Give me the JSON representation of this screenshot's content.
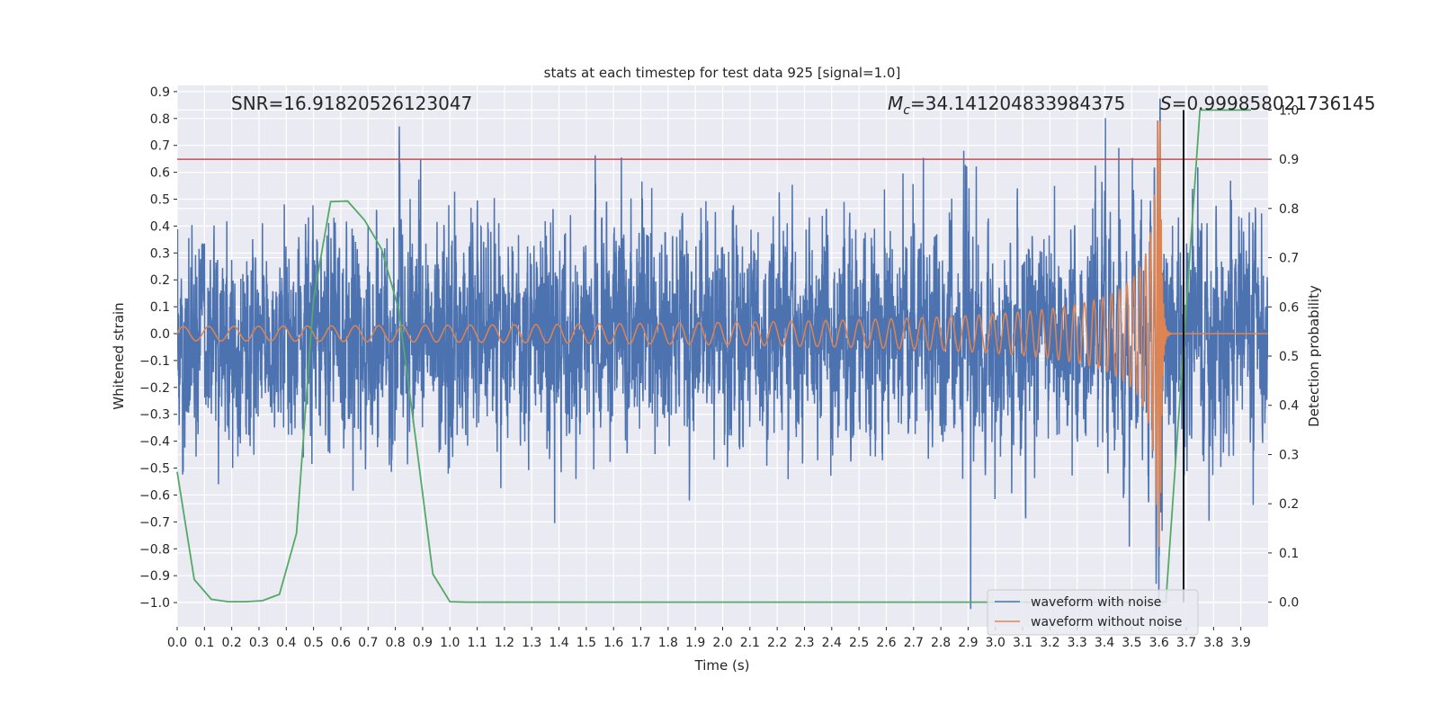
{
  "chart_data": {
    "type": "line",
    "title": "stats at each timestep for test data 925 [signal=1.0]",
    "xlabel": "Time (s)",
    "ylabel": "Whitened strain",
    "ylabel_right": "Detection probability",
    "xlim": [
      0.0,
      4.0
    ],
    "ylim": [
      -1.09,
      0.923
    ],
    "ylim_right": [
      -0.05,
      1.05
    ],
    "grid": true,
    "legend_position": "lower-right",
    "x_ticks": [
      "0.0",
      "0.1",
      "0.2",
      "0.3",
      "0.4",
      "0.5",
      "0.6",
      "0.7",
      "0.8",
      "0.9",
      "1.0",
      "1.1",
      "1.2",
      "1.3",
      "1.4",
      "1.5",
      "1.6",
      "1.7",
      "1.8",
      "1.9",
      "2.0",
      "2.1",
      "2.2",
      "2.3",
      "2.4",
      "2.5",
      "2.6",
      "2.7",
      "2.8",
      "2.9",
      "3.0",
      "3.1",
      "3.2",
      "3.3",
      "3.4",
      "3.5",
      "3.6",
      "3.7",
      "3.8",
      "3.9"
    ],
    "y_ticks": [
      "0.9",
      "0.8",
      "0.7",
      "0.6",
      "0.5",
      "0.4",
      "0.3",
      "0.2",
      "0.1",
      "0.0",
      "−0.1",
      "−0.2",
      "−0.3",
      "−0.4",
      "−0.5",
      "−0.6",
      "−0.7",
      "−0.8",
      "−0.9",
      "−1.0"
    ],
    "y_ticks_right": [
      "1.0",
      "0.9",
      "0.8",
      "0.7",
      "0.6",
      "0.5",
      "0.4",
      "0.3",
      "0.2",
      "0.1",
      "0.0"
    ],
    "annotations": {
      "snr": "SNR=16.91820526123047",
      "mc_symbol": "M",
      "mc_sub": "c",
      "mc_value": "=34.141204833984375",
      "s_symbol": "S",
      "s_value": "=0.999858021736145"
    },
    "series": [
      {
        "name": "waveform with noise",
        "color": "#4c72b0",
        "axis": "left"
      },
      {
        "name": "waveform without noise",
        "color": "#dd8452",
        "axis": "left"
      },
      {
        "axis": "right",
        "color": "#55a868",
        "x_step": 0.0625,
        "values": [
          0.265,
          0.046,
          0.006,
          0.001,
          0.001,
          0.003,
          0.016,
          0.14,
          0.616,
          0.814,
          0.815,
          0.776,
          0.717,
          0.594,
          0.33,
          0.057,
          0.001,
          0,
          0,
          0,
          0,
          0,
          0,
          0,
          0,
          0,
          0,
          0,
          0,
          0,
          0,
          0,
          0,
          0,
          0,
          0,
          0,
          0,
          0,
          0,
          0,
          0,
          0,
          0,
          0,
          0,
          0,
          0,
          0,
          0,
          0,
          0,
          0,
          0,
          0,
          0,
          0,
          0,
          0,
          0.5,
          1.0,
          1.0,
          1.0,
          1.0
        ]
      }
    ],
    "threshold_line": {
      "value": 0.9,
      "axis": "right",
      "color": "#c44e52"
    },
    "vertical_line": {
      "x": 3.69,
      "color": "#000000"
    }
  }
}
